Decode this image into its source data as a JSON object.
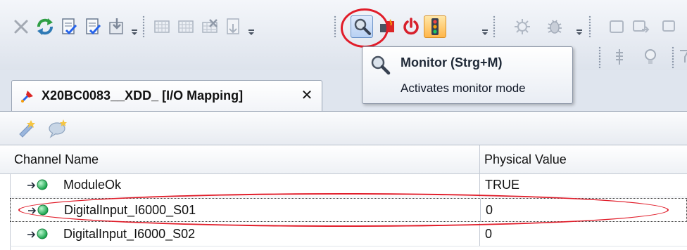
{
  "toolbar": {
    "row1_icons": [
      "close-x-icon",
      "refresh-icon",
      "check-document-icon",
      "check-document-icon",
      "download-document-icon",
      "grid-icon",
      "grid-icon",
      "delete-grid-icon",
      "import-document-icon",
      "monitor-magnifier-icon",
      "fire-alarm-icon",
      "power-icon",
      "traffic-light-icon",
      "bug-gear-icon",
      "bug-icon",
      "rectangle-icon",
      "window-arrow-icon"
    ],
    "row2_icons": [
      "step-icon",
      "lightbulb-icon",
      "filter-icon"
    ]
  },
  "tooltip": {
    "title": "Monitor  (Strg+M)",
    "description": "Activates monitor mode"
  },
  "tab": {
    "title": "X20BC0083__XDD_ [I/O Mapping]",
    "close_glyph": "✕"
  },
  "editor_toolbar": {
    "icons": [
      "new-item-icon",
      "comment-icon"
    ]
  },
  "table": {
    "columns": [
      "Channel Name",
      "Physical Value"
    ],
    "rows": [
      {
        "name": "ModuleOk",
        "value": "TRUE",
        "selected": false
      },
      {
        "name": "DigitalInput_I6000_S01",
        "value": "0",
        "selected": true
      },
      {
        "name": "DigitalInput_I6000_S02",
        "value": "0",
        "selected": false
      }
    ]
  },
  "colors": {
    "highlight_ring": "#e11d2a",
    "led_green": "#22c55e",
    "power_red": "#d71f2b"
  }
}
